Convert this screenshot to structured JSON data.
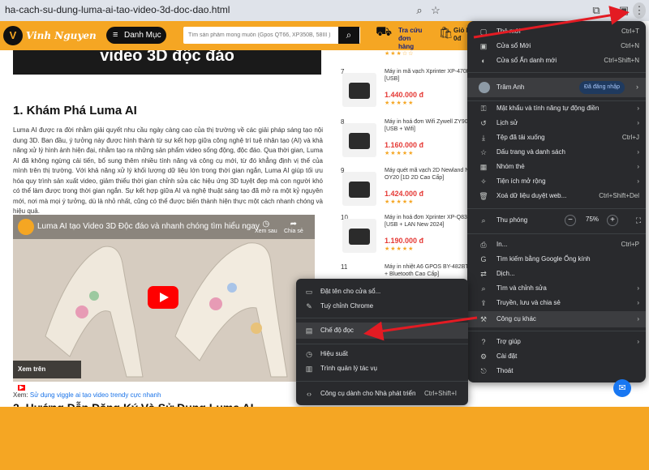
{
  "browser": {
    "url": "ha-cach-su-dung-luma-ai-tao-video-3d-doc-dao.html"
  },
  "site": {
    "logo_text": "Vinh Nguyen",
    "menu_label": "Danh Mục",
    "search_placeholder": "Tìm sản phẩm mong muốn (Gpos QT66, XP350B, 58III )",
    "order_label_1": "Tra cứu",
    "order_label_2": "đơn hàng",
    "cart_label_1": "Giỏ h",
    "cart_label_2": "0đ",
    "cart_count": "0"
  },
  "article": {
    "hero_text": "video 3D độc đáo",
    "heading": "1. Khám Phá Luma AI",
    "paragraph": "Luma AI được ra đời nhằm giải quyết nhu cầu ngày càng cao của thị trường về các giải pháp sáng tạo nội dung 3D. Ban đầu, ý tưởng này được hình thành từ sự kết hợp giữa công nghệ trí tuệ nhân tạo (AI) và khả năng xử lý hình ảnh hiện đại, nhằm tạo ra những sản phẩm video sống động, độc đáo. Qua thời gian, Luma AI đã không ngừng cải tiến, bổ sung thêm nhiều tính năng và công cụ mới, từ đó khẳng định vị thế của mình trên thị trường. Với khả năng xử lý khối lượng dữ liệu lớn trong thời gian ngắn, Luma AI giúp tối ưu hóa quy trình sản xuất video, giảm thiểu thời gian chỉnh sửa các hiệu ứng 3D tuyệt đẹp mà con người khó có thể làm được trong thời gian ngắn. Sự kết hợp giữa AI và nghệ thuật sáng tạo đã mở ra một kỷ nguyên mới, nơi mà mọi ý tưởng, dù là nhỏ nhất, cũng có thể được biến thành hiện thực một cách nhanh chóng và hiệu quả.",
    "video_title": "Luma AI tạo Video 3D Độc đáo và nhanh chóng tìm hiểu ngay",
    "watch_later": "Xem sau",
    "share": "Chia sẻ",
    "watch_on": "Xem trên",
    "youtube": "YouTube",
    "see_also_prefix": "Xem:",
    "see_also_link": "Sử dụng viggle ai tạo video trendy cực nhanh",
    "heading2": "2. Hướng Dẫn Đăng Ký Và Sử Dụng Luma AI"
  },
  "products": [
    {
      "num": "",
      "name": "",
      "price": "",
      "stars": "★★★☆☆"
    },
    {
      "num": "7",
      "name": "Máy in mã vạch Xprinter XP-470B [USB]",
      "price": "1.440.000 đ",
      "stars": "★★★★★"
    },
    {
      "num": "8",
      "name": "Máy in hoá đơn Wifi Zywell ZY908 [USB + Wifi]",
      "price": "1.160.000 đ",
      "stars": "★★★★★"
    },
    {
      "num": "9",
      "name": "Máy quét mã vạch 2D Newland NLS-OY20 [1D 2D Cao Cấp]",
      "price": "1.424.000 đ",
      "stars": "★★★★★"
    },
    {
      "num": "10",
      "name": "Máy in hoá đơn Xprinter XP-Q838L [USB + LAN New 2024]",
      "price": "1.190.000 đ",
      "stars": "★★★★★"
    },
    {
      "num": "11",
      "name": "Máy in nhiệt A6 GPOS BY-482BT [USB + Bluetooth Cao Cấp]",
      "price": "",
      "stars": ""
    }
  ],
  "chrome_menu": {
    "items": [
      {
        "icon": "▢",
        "label": "Thẻ mới",
        "shortcut": "Ctrl+T"
      },
      {
        "icon": "▣",
        "label": "Cửa sổ Mới",
        "shortcut": "Ctrl+N"
      },
      {
        "icon": "◐",
        "label": "Cửa sổ Ẩn danh mới",
        "shortcut": "Ctrl+Shift+N"
      }
    ],
    "profile_name": "Trâm Anh",
    "signed_in": "Đã đăng nhập",
    "items2": [
      {
        "icon": "⚿",
        "label": "Mật khẩu và tính năng tự động điền"
      },
      {
        "icon": "↺",
        "label": "Lịch sử"
      },
      {
        "icon": "⤓",
        "label": "Tệp đã tải xuống",
        "shortcut": "Ctrl+J"
      },
      {
        "icon": "☆",
        "label": "Dấu trang và danh sách"
      },
      {
        "icon": "▦",
        "label": "Nhóm thẻ"
      },
      {
        "icon": "✧",
        "label": "Tiện ích mở rộng"
      },
      {
        "icon": "🗑",
        "label": "Xoá dữ liệu duyệt web...",
        "shortcut": "Ctrl+Shift+Del"
      }
    ],
    "zoom_label": "Thu phóng",
    "zoom_value": "75%",
    "items3": [
      {
        "icon": "⎙",
        "label": "In...",
        "shortcut": "Ctrl+P"
      },
      {
        "icon": "G",
        "label": "Tìm kiếm bằng Google Ống kính"
      },
      {
        "icon": "⇄",
        "label": "Dịch..."
      },
      {
        "icon": "⌕",
        "label": "Tìm và chỉnh sửa"
      },
      {
        "icon": "⇪",
        "label": "Truyền, lưu và chia sẻ"
      },
      {
        "icon": "⚒",
        "label": "Công cụ khác"
      }
    ],
    "items4": [
      {
        "icon": "?",
        "label": "Trợ giúp"
      },
      {
        "icon": "⚙",
        "label": "Cài đặt"
      },
      {
        "icon": "⎋",
        "label": "Thoát"
      }
    ]
  },
  "submenu": {
    "items": [
      {
        "icon": "▭",
        "label": "Đặt tên cho cửa sổ..."
      },
      {
        "icon": "✎",
        "label": "Tuỳ chỉnh Chrome"
      },
      {
        "icon": "▤",
        "label": "Chế độ đọc"
      },
      {
        "icon": "◷",
        "label": "Hiệu suất"
      },
      {
        "icon": "▥",
        "label": "Trình quản lý tác vụ"
      },
      {
        "icon": "‹›",
        "label": "Công cụ dành cho Nhà phát triển",
        "shortcut": "Ctrl+Shift+I"
      }
    ]
  },
  "colors": {
    "brand": "#f5a623",
    "menu_bg": "#292a2d",
    "annotation_arrow": "#e31b23"
  }
}
